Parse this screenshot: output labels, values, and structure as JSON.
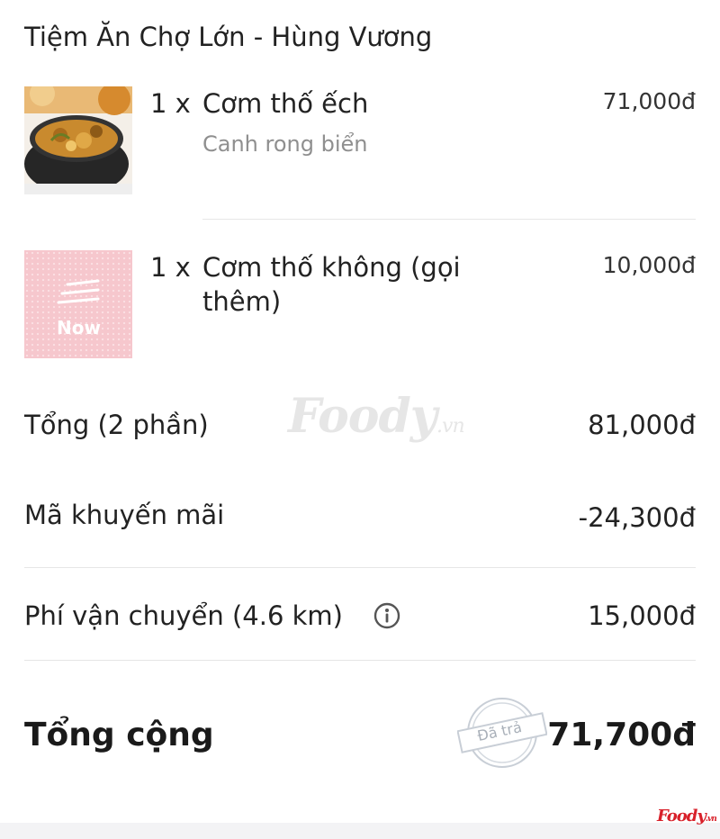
{
  "restaurant": {
    "name": "Tiệm Ăn Chợ Lớn - Hùng Vương"
  },
  "items": [
    {
      "qty": "1 x",
      "name": "Cơm thố ếch",
      "option": "Canh rong biển",
      "price": "71,000đ"
    },
    {
      "qty": "1 x",
      "name": "Cơm thố không (gọi thêm)",
      "price": "10,000đ",
      "placeholder_logo": "Now"
    }
  ],
  "summary": {
    "subtotal_label": "Tổng (2 phần)",
    "subtotal_value": "81,000đ",
    "promo_label": "Mã khuyến mãi",
    "promo_value": "-24,300đ",
    "shipping_label": "Phí vận chuyển (4.6 km)",
    "shipping_value": "15,000đ",
    "total_label": "Tổng cộng",
    "total_value": "71,700đ",
    "paid_stamp": "Đã trả"
  },
  "watermark": {
    "main": "Foody",
    "suffix": ".vn"
  },
  "corner_logo": {
    "main": "Foody",
    "suffix": ".vn"
  },
  "icons": {
    "info": "info-icon"
  },
  "colors": {
    "brand_red": "#d8202a",
    "stamp_gray": "#c8ced6",
    "placeholder_pink": "#f6c7cd"
  }
}
